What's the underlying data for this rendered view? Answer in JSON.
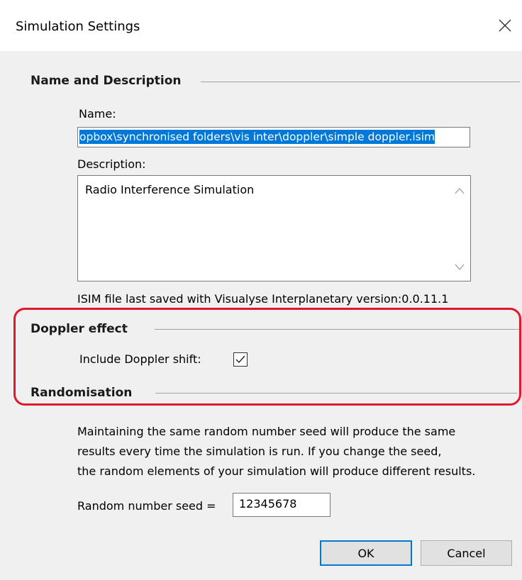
{
  "window": {
    "title": "Simulation Settings"
  },
  "name_section": {
    "heading": "Name and Description",
    "name_label": "Name:",
    "name_value": "opbox\\synchronised folders\\vis inter\\doppler\\simple doppler.isim",
    "description_label": "Description:",
    "description_value": "Radio Interference Simulation",
    "version_note": "ISIM file last saved with Visualyse Interplanetary version:0.0.11.1"
  },
  "doppler_section": {
    "heading": "Doppler effect",
    "include_label": "Include Doppler shift:",
    "include_checked": true
  },
  "random_section": {
    "heading": "Randomisation",
    "info_line1": "Maintaining the same random number seed will produce the same",
    "info_line2": "results every time the simulation is run. If you change the seed,",
    "info_line3": "the random elements of your simulation will produce different results.",
    "seed_label": "Random number seed =",
    "seed_value": "12345678"
  },
  "buttons": {
    "ok": "OK",
    "cancel": "Cancel"
  },
  "colors": {
    "accent": "#0078d7",
    "highlight": "#e0182b",
    "dialog_bg": "#f0f0f0"
  }
}
